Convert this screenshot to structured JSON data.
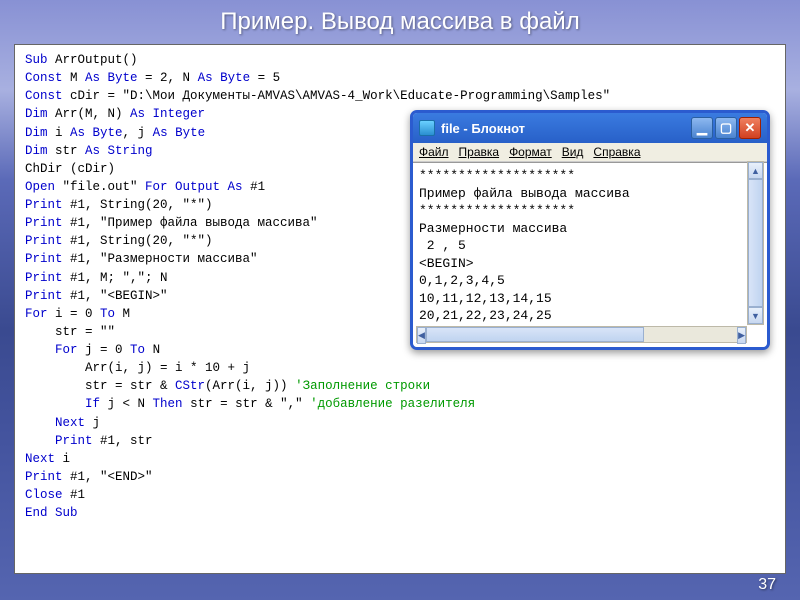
{
  "slide": {
    "title": "Пример. Вывод массива в файл",
    "number": "37"
  },
  "code": {
    "l01a": "Sub",
    "l01b": " ArrOutput()",
    "l02a": "Const",
    "l02b": " M ",
    "l02c": "As Byte",
    "l02d": " = 2, N ",
    "l02e": "As Byte",
    "l02f": " = 5",
    "l03a": "Const",
    "l03b": " cDir = \"D:\\Мои Документы-AMVAS\\AMVAS-4_Work\\Educate-Programming\\Samples\"",
    "l04a": "Dim",
    "l04b": " Arr(M, N) ",
    "l04c": "As Integer",
    "l05a": "Dim",
    "l05b": " i ",
    "l05c": "As Byte",
    "l05d": ", j ",
    "l05e": "As Byte",
    "l06a": "Dim",
    "l06b": " str ",
    "l06c": "As String",
    "l07": "",
    "l08": "ChDir (cDir)",
    "l09a": "Open",
    "l09b": " \"file.out\" ",
    "l09c": "For Output As",
    "l09d": " #1",
    "l10a": "Print",
    "l10b": " #1, String(20, \"*\")",
    "l11a": "Print",
    "l11b": " #1, \"Пример файла вывода массива\"",
    "l12a": "Print",
    "l12b": " #1, String(20, \"*\")",
    "l13a": "Print",
    "l13b": " #1, \"Размерности массива\"",
    "l14a": "Print",
    "l14b": " #1, M; \",\"; N",
    "l15a": "Print",
    "l15b": " #1, \"<BEGIN>\"",
    "l16a": "For",
    "l16b": " i = 0 ",
    "l16c": "To",
    "l16d": " M",
    "l17": "    str = \"\"",
    "l18a": "    ",
    "l18b": "For",
    "l18c": " j = 0 ",
    "l18d": "To",
    "l18e": " N",
    "l19": "        Arr(i, j) = i * 10 + j",
    "l20a": "        str = str & ",
    "l20b": "CStr",
    "l20c": "(Arr(i, j)) ",
    "l20d": "'Заполнение строки",
    "l21a": "        ",
    "l21b": "If",
    "l21c": " j < N ",
    "l21d": "Then",
    "l21e": " str = str & \",\" ",
    "l21f": "'добавление разелителя",
    "l22a": "    ",
    "l22b": "Next",
    "l22c": " j",
    "l23a": "    ",
    "l23b": "Print",
    "l23c": " #1, str",
    "l24a": "Next",
    "l24b": " i",
    "l25a": "Print",
    "l25b": " #1, \"<END>\"",
    "l26a": "Close",
    "l26b": " #1",
    "l27": "End Sub"
  },
  "notepad": {
    "title": "file - Блокнот",
    "menu": {
      "file": "Файл",
      "edit": "Правка",
      "format": "Формат",
      "view": "Вид",
      "help": "Справка"
    },
    "content": "********************\nПример файла вывода массива\n********************\nРазмерности массива\n 2 , 5\n<BEGIN>\n0,1,2,3,4,5\n10,11,12,13,14,15\n20,21,22,23,24,25"
  }
}
